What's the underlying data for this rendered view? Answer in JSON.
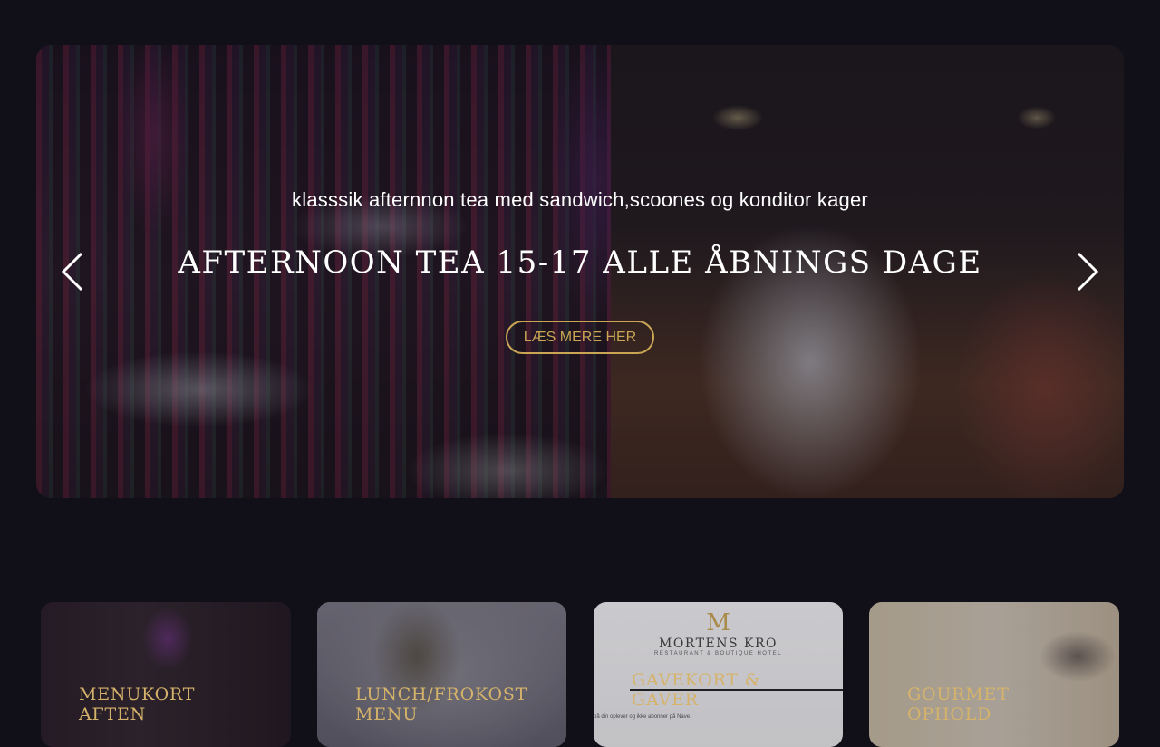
{
  "hero": {
    "subtitle": "klasssik afternnon tea med sandwich,scoones og konditor kager",
    "title": "AFTERNOON TEA 15-17 ALLE ÅBNINGS DAGE",
    "cta_label": "LÆS MERE HER",
    "prev_icon": "chevron-left-icon",
    "next_icon": "chevron-right-icon"
  },
  "cards": [
    {
      "title": "MENUKORT\nAFTEN"
    },
    {
      "title": "LUNCH/FROKOST\nMENU"
    },
    {
      "title": "GAVEKORT &\nGAVER",
      "brand_logo": "M",
      "brand_name": "MORTENS KRO",
      "brand_sub": "RESTAURANT & BOUTIQUE HOTEL",
      "small_text": "på din oplever og ikke abonner på Nave."
    },
    {
      "title": "GOURMET\nOPHOLD"
    }
  ],
  "colors": {
    "background": "#111019",
    "accent_gold": "#c9a554",
    "card_title_gold": "#d6b36a",
    "text_white": "#ffffff"
  }
}
